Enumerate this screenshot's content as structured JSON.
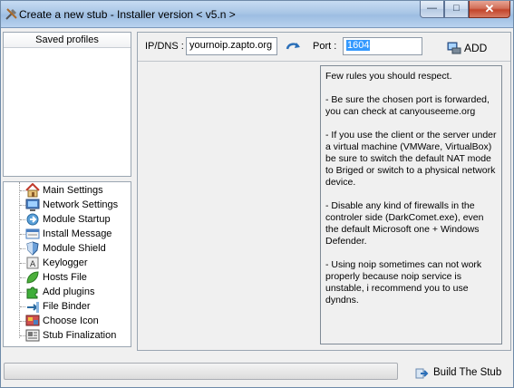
{
  "window": {
    "title": "Create a new stub - Installer version < v5.n >",
    "controls": {
      "minimize": "—",
      "maximize": "□",
      "close": "✕"
    }
  },
  "profiles": {
    "header": "Saved profiles"
  },
  "nav": {
    "items": [
      {
        "label": "Main Settings",
        "icon": "house-icon"
      },
      {
        "label": "Network Settings",
        "icon": "monitor-icon"
      },
      {
        "label": "Module Startup",
        "icon": "startup-icon"
      },
      {
        "label": "Install Message",
        "icon": "message-icon"
      },
      {
        "label": "Module Shield",
        "icon": "shield-icon"
      },
      {
        "label": "Keylogger",
        "icon": "keylogger-icon"
      },
      {
        "label": "Hosts File",
        "icon": "leaf-icon"
      },
      {
        "label": "Add plugins",
        "icon": "puzzle-icon"
      },
      {
        "label": "File Binder",
        "icon": "binder-icon"
      },
      {
        "label": "Choose Icon",
        "icon": "choose-icon-icon"
      },
      {
        "label": "Stub Finalization",
        "icon": "finalize-icon"
      }
    ]
  },
  "network": {
    "ip_label": "IP/DNS :",
    "ip_value": "yournoip.zapto.org",
    "port_label": "Port :",
    "port_value": "1604",
    "add_label": "ADD"
  },
  "rules": {
    "paragraphs": [
      "Few rules you should respect.",
      "- Be sure the chosen port is forwarded, you can check at canyouseeme.org",
      "- If you use the client or the server under a virtual machine (VMWare, VirtualBox) be sure to switch the default NAT mode to Briged or switch to a physical network device.",
      "- Disable any kind of firewalls in the controler side (DarkComet.exe), even the default Microsoft one + Windows Defender.",
      "- Using noip sometimes can not work properly because noip service is unstable, i recommend you to use dyndns."
    ]
  },
  "build": {
    "label": "Build The Stub",
    "progress": 0
  },
  "colors": {
    "accent": "#3399ff",
    "titlebar": "#a9c6e6",
    "close": "#c3452b"
  }
}
